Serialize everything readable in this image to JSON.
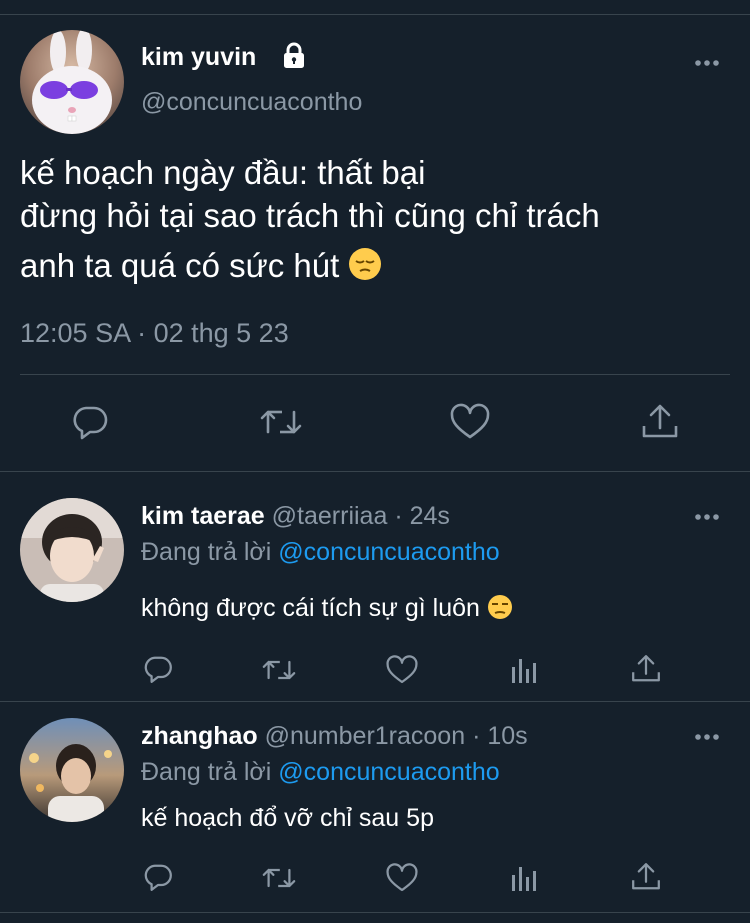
{
  "main_tweet": {
    "display_name": "kim yuvin",
    "handle": "@concuncuacontho",
    "text_lines": [
      "kế hoạch ngày đầu: thất bại",
      "đừng hỏi tại sao trách thì cũng chỉ trách",
      "anh ta quá có sức hút"
    ],
    "timestamp": "12:05 SA · 02 thg 5 23",
    "icons": [
      "lock-icon",
      "more-icon",
      "reply-icon",
      "retweet-icon",
      "like-icon",
      "share-icon"
    ]
  },
  "replies": [
    {
      "display_name": "kim taerae",
      "handle": "@taerriiaa",
      "time": "· 24s",
      "replying_prefix": "Đang trả lời",
      "replying_to": "@concuncuacontho",
      "text": "không được cái tích sự gì luôn"
    },
    {
      "display_name": "zhanghao",
      "handle": "@number1racoon",
      "time": "· 10s",
      "replying_prefix": "Đang trả lời",
      "replying_to": "@concuncuacontho",
      "text": "kế hoạch đổ vỡ chỉ sau 5p"
    }
  ],
  "colors": {
    "background": "#15202b",
    "text": "#ffffff",
    "secondary_text": "#8b98a5",
    "link": "#1d9bf0",
    "divider": "#38444d"
  }
}
